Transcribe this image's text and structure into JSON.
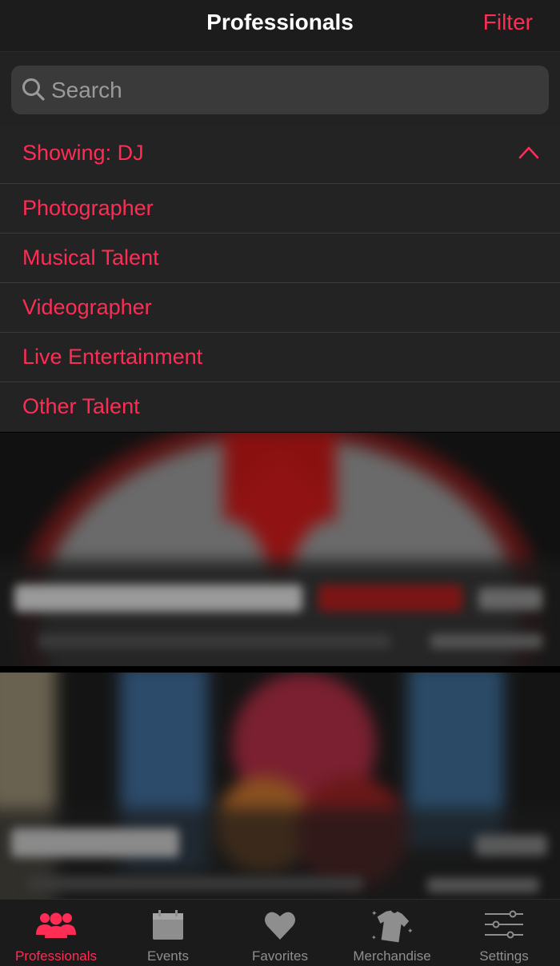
{
  "header": {
    "title": "Professionals",
    "filter_label": "Filter"
  },
  "search": {
    "placeholder": "Search",
    "value": ""
  },
  "category_filter": {
    "showing_label": "Showing: DJ",
    "expanded": true,
    "options": [
      "Photographer",
      "Musical Talent",
      "Videographer",
      "Live Entertainment",
      "Other Talent"
    ]
  },
  "tabs": [
    {
      "label": "Professionals",
      "icon": "people-icon",
      "active": true
    },
    {
      "label": "Events",
      "icon": "calendar-icon",
      "active": false
    },
    {
      "label": "Favorites",
      "icon": "heart-icon",
      "active": false
    },
    {
      "label": "Merchandise",
      "icon": "shirt-icon",
      "active": false
    },
    {
      "label": "Settings",
      "icon": "sliders-icon",
      "active": false
    }
  ],
  "colors": {
    "accent": "#ff2d55",
    "inactive": "#8e8e8e",
    "background": "#1c1c1c"
  }
}
